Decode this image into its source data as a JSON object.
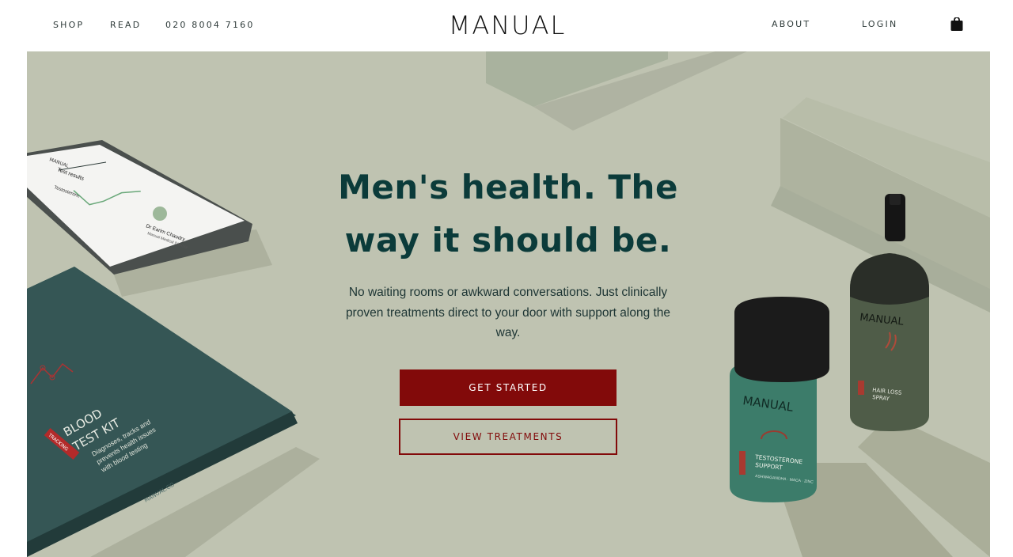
{
  "nav": {
    "shop": "SHOP",
    "read": "READ",
    "phone": "020 8004 7160",
    "logo": "MANUAL",
    "about": "ABOUT",
    "login": "LOGIN",
    "cart_icon": "shopping-bag-icon"
  },
  "hero": {
    "headline": "Men's health. The way it should be.",
    "subtext": "No waiting rooms or awkward conversations. Just clinically proven treatments direct to your door with support along the way.",
    "primary_cta": "GET STARTED",
    "secondary_cta": "VIEW TREATMENTS"
  },
  "products": {
    "phone_screen": {
      "brand": "MANUAL",
      "title": "Test results",
      "chart_label": "Testosterone",
      "doctor_name": "Dr Earim Chaudry",
      "doctor_role": "Manual Medical Director"
    },
    "blood_kit": {
      "brand": "MANUAL",
      "title_line1": "BLOOD",
      "title_line2": "TEST KIT",
      "desc_line1": "Diagnoses, tracks and",
      "desc_line2": "prevents health issues",
      "desc_line3": "with blood testing",
      "tag": "TRACKING",
      "footer": "MANUAL.CO"
    },
    "jar": {
      "brand": "MANUAL",
      "name_line1": "TESTOSTERONE",
      "name_line2": "SUPPORT",
      "ingredients": "ASHWAGANDHA · MACA · ZINC",
      "tag": "HEALTH"
    },
    "spray": {
      "brand": "MANUAL",
      "name_line1": "HAIR LOSS",
      "name_line2": "SPRAY",
      "tag": "HAIR"
    }
  },
  "colors": {
    "hero_bg": "#bfc3b1",
    "headline": "#0b3b3a",
    "accent": "#820a0a"
  }
}
